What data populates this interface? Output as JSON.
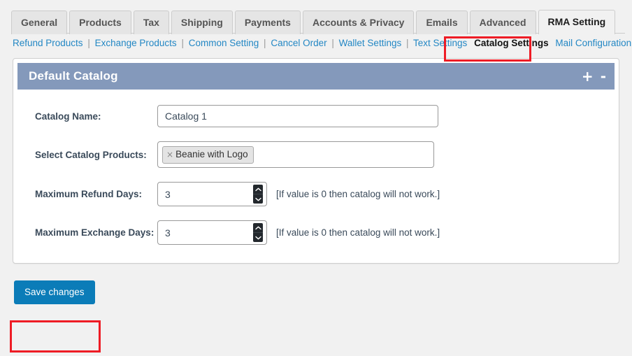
{
  "tabs": [
    {
      "label": "General",
      "active": false
    },
    {
      "label": "Products",
      "active": false
    },
    {
      "label": "Tax",
      "active": false
    },
    {
      "label": "Shipping",
      "active": false
    },
    {
      "label": "Payments",
      "active": false
    },
    {
      "label": "Accounts & Privacy",
      "active": false
    },
    {
      "label": "Emails",
      "active": false
    },
    {
      "label": "Advanced",
      "active": false
    },
    {
      "label": "RMA Setting",
      "active": true
    }
  ],
  "subnav": {
    "items": [
      {
        "label": "Refund Products",
        "current": false
      },
      {
        "label": "Exchange Products",
        "current": false
      },
      {
        "label": "Common Setting",
        "current": false
      },
      {
        "label": "Cancel Order",
        "current": false
      },
      {
        "label": "Wallet Settings",
        "current": false
      },
      {
        "label": "Text Settings",
        "current": false
      },
      {
        "label": "Catalog Settings",
        "current": true
      },
      {
        "label": "Mail Configuration",
        "current": false
      }
    ],
    "separator": "|"
  },
  "panel": {
    "title": "Default Catalog",
    "add_icon": "+",
    "remove_icon": "-",
    "header_color": "#8499bb"
  },
  "form": {
    "catalog_name": {
      "label": "Catalog Name:",
      "value": "Catalog 1",
      "placeholder": ""
    },
    "catalog_products": {
      "label": "Select Catalog Products:",
      "tokens": [
        {
          "remove_icon": "×",
          "label": "Beanie with Logo"
        }
      ]
    },
    "max_refund_days": {
      "label": "Maximum Refund Days:",
      "value": "3",
      "hint": "[If value is 0 then catalog will not work.]"
    },
    "max_exchange_days": {
      "label": "Maximum Exchange Days:",
      "value": "3",
      "hint": "[If value is 0 then catalog will not work.]"
    }
  },
  "actions": {
    "save_label": "Save changes",
    "save_color": "#0b7cb8"
  },
  "annotations": {
    "highlight_color": "#ee1c25"
  }
}
